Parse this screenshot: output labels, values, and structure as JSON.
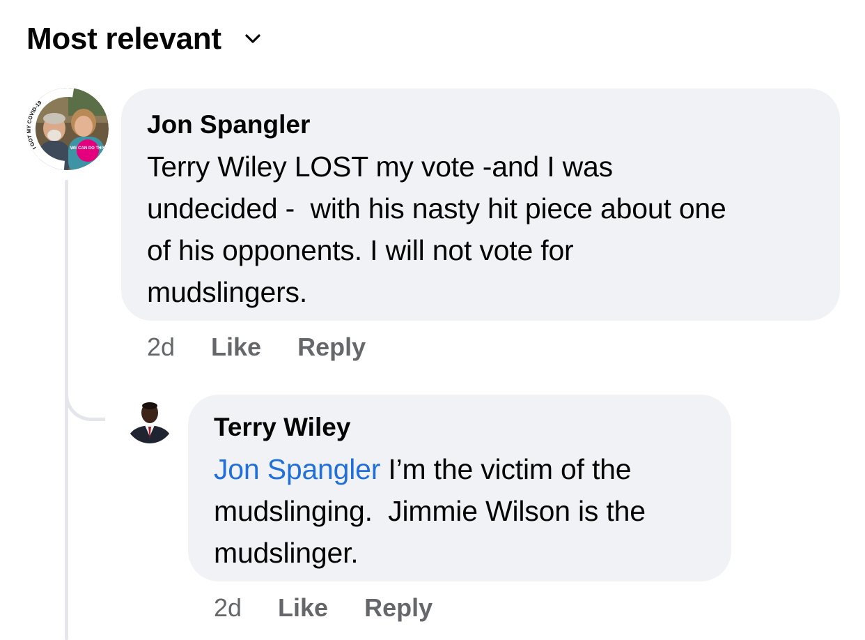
{
  "sort": {
    "label": "Most relevant",
    "icon": "chevron-down-icon"
  },
  "comments": [
    {
      "author": "Jon Spangler",
      "text": "Terry Wiley LOST my vote -and I was\nundecided -  with his nasty hit piece about one\nof his opponents. I will not vote for\nmudslingers.",
      "time": "2d",
      "like_label": "Like",
      "reply_label": "Reply",
      "avatar": {
        "badge_ring_text": "I GOT MY COVID-19 VACCINE",
        "badge_text": "WE CAN DO THIS"
      },
      "replies": [
        {
          "author": "Terry Wiley",
          "mention": "Jon Spangler",
          "text": " I’m the victim of the\nmudslinging.  Jimmie Wilson is the\nmudslinger.",
          "time": "2d",
          "like_label": "Like",
          "reply_label": "Reply"
        }
      ]
    }
  ],
  "colors": {
    "bubble": "#f0f2f5",
    "mention": "#216fdb",
    "meta_text": "#65676b",
    "thread_line": "#e4e6eb"
  }
}
